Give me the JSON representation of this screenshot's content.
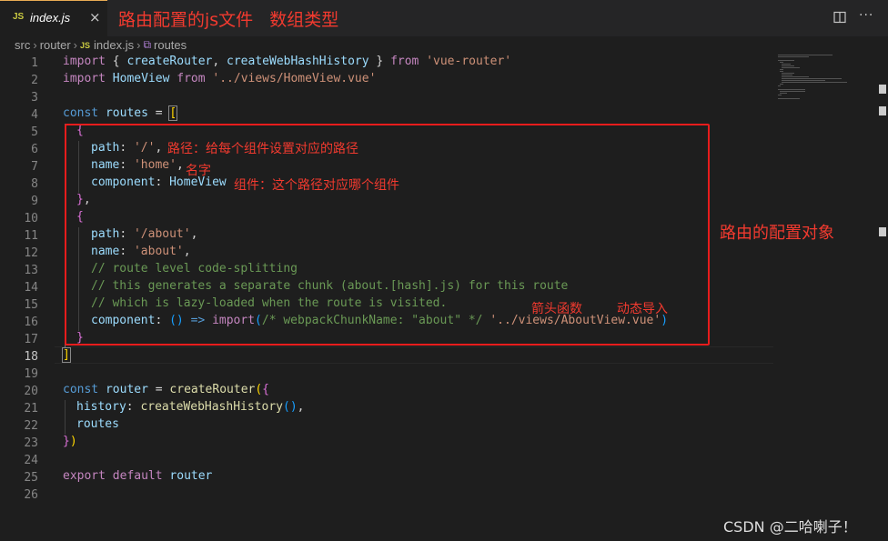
{
  "tab": {
    "badge": "JS",
    "filename": "index.js",
    "close": "×"
  },
  "tab_annotation": "路由配置的js文件   数组类型",
  "breadcrumb": {
    "items": [
      "src",
      "router",
      "index.js",
      "routes"
    ],
    "sep": "›",
    "badge": "JS"
  },
  "line_numbers": [
    "1",
    "2",
    "3",
    "4",
    "5",
    "6",
    "7",
    "8",
    "9",
    "10",
    "11",
    "12",
    "13",
    "14",
    "15",
    "16",
    "17",
    "18",
    "19",
    "20",
    "21",
    "22",
    "23",
    "24",
    "25",
    "26"
  ],
  "code": {
    "l1": [
      "import",
      " { ",
      "createRouter",
      ", ",
      "createWebHashHistory",
      " } ",
      "from",
      " ",
      "'vue-router'"
    ],
    "l2": [
      "import",
      " ",
      "HomeView",
      " ",
      "from",
      " ",
      "'../views/HomeView.vue'"
    ],
    "l4": [
      "const",
      " ",
      "routes",
      " = ",
      "["
    ],
    "l5": [
      "{"
    ],
    "l6": [
      "path",
      ": ",
      "'/'",
      ","
    ],
    "l7": [
      "name",
      ": ",
      "'home'",
      ","
    ],
    "l8": [
      "component",
      ": ",
      "HomeView"
    ],
    "l9": [
      "}",
      ","
    ],
    "l10": [
      "{"
    ],
    "l11": [
      "path",
      ": ",
      "'/about'",
      ","
    ],
    "l12": [
      "name",
      ": ",
      "'about'",
      ","
    ],
    "l13": "// route level code-splitting",
    "l14": "// this generates a separate chunk (about.[hash].js) for this route",
    "l15": "// which is lazy-loaded when the route is visited.",
    "l16": [
      "component",
      ": ",
      "()",
      " ",
      "=>",
      " ",
      "import",
      "(",
      "/* webpackChunkName: \"about\" */",
      " ",
      "'../views/AboutView.vue'",
      ")"
    ],
    "l17": [
      "}"
    ],
    "l18": [
      "]"
    ],
    "l20": [
      "const",
      " ",
      "router",
      " = ",
      "createRouter",
      "(",
      "{"
    ],
    "l21": [
      "history",
      ": ",
      "createWebHashHistory",
      "()",
      ","
    ],
    "l22": [
      "routes"
    ],
    "l23": [
      "}",
      ")"
    ],
    "l25": [
      "export",
      " ",
      "default",
      " ",
      "router"
    ]
  },
  "annotations": {
    "path": "路径：给每个组件设置对应的路径",
    "name": "名字",
    "component": "组件：这个路径对应哪个组件",
    "routes_config": "路由的配置对象",
    "arrow_fn": "箭头函数",
    "dynamic_import": "动态导入"
  },
  "watermark": "CSDN @二哈喇子！",
  "colors": {
    "accent_annotation": "#f23a2f",
    "highlight_box": "#e81c1c",
    "editor_bg": "#1e1e1e"
  }
}
